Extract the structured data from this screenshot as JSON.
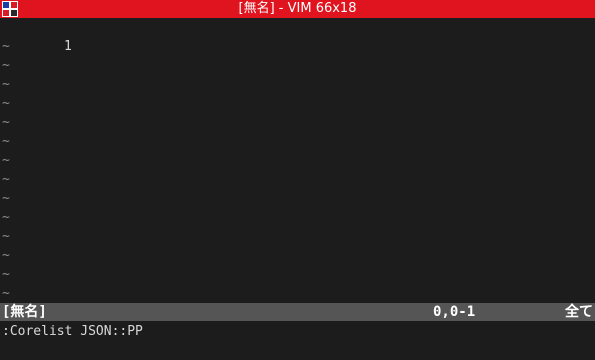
{
  "window": {
    "title": "[無名] - VIM 66x18",
    "titlebar_color": "#e0141f"
  },
  "editor": {
    "line_number": "1",
    "empty_line_marker": "~",
    "empty_line_count": 14
  },
  "statusline": {
    "filename": "[無名]",
    "position": "0,0-1",
    "scroll": "全て"
  },
  "cmdline": {
    "text": ":Corelist JSON::PP"
  },
  "icons": {
    "app": "vim-app-icon"
  }
}
